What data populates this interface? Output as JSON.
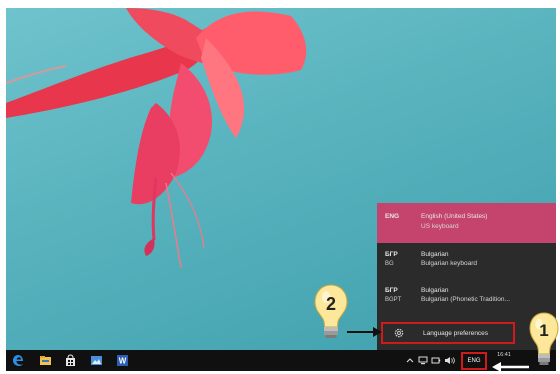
{
  "language_menu": {
    "items": [
      {
        "code": "ENG",
        "sub_code": "",
        "name": "English (United States)",
        "keyboard": "US keyboard",
        "active": true
      },
      {
        "code": "БГР",
        "sub_code": "BG",
        "name": "Bulgarian",
        "keyboard": "Bulgarian keyboard",
        "active": false
      },
      {
        "code": "БГР",
        "sub_code": "BGPT",
        "name": "Bulgarian",
        "keyboard": "Bulgarian (Phonetic Tradition...",
        "active": false
      }
    ],
    "preferences_label": "Language preferences"
  },
  "taskbar": {
    "pinned_icons": [
      "edge-icon",
      "file-explorer-icon",
      "store-icon",
      "photos-icon",
      "word-icon"
    ],
    "tray_icons": [
      "chevron-up-icon",
      "network-icon",
      "battery-icon",
      "volume-icon"
    ],
    "input_indicator": "ENG",
    "clock_time": "16:41"
  },
  "callouts": [
    {
      "number": "1"
    },
    {
      "number": "2"
    }
  ],
  "colors": {
    "desktop": "#57b2bd",
    "popup_bg": "#2b2b2b",
    "active_row": "#c5446e",
    "highlight_border": "#d21a1a",
    "taskbar_bg": "#101010"
  }
}
